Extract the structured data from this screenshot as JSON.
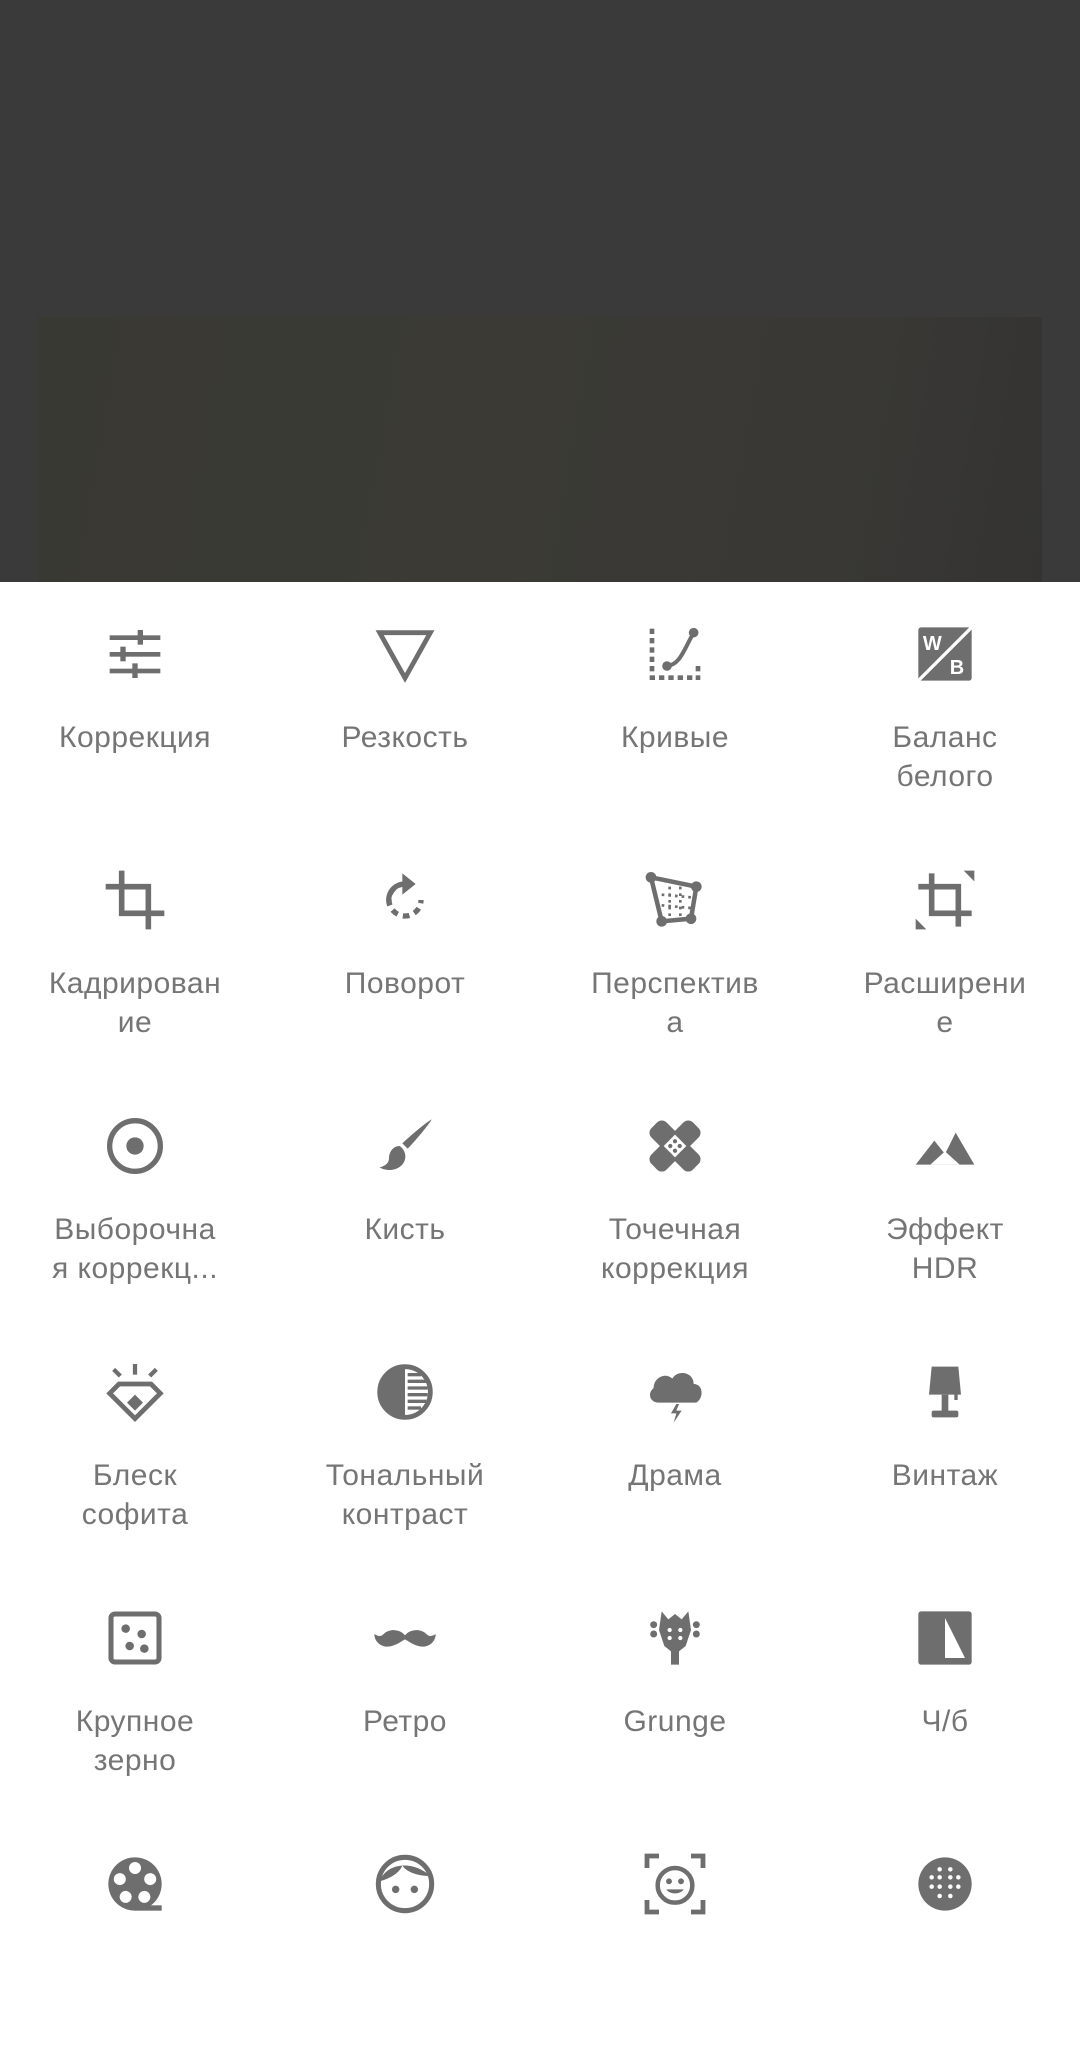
{
  "colors": {
    "icon": "#6e6e6e",
    "label": "#757575",
    "preview_bg": "#3a3a3a",
    "panel_bg": "#ffffff"
  },
  "tools": [
    {
      "id": "tune",
      "icon": "sliders-icon",
      "label": "Коррекция"
    },
    {
      "id": "details",
      "icon": "triangle-down-icon",
      "label": "Резкость"
    },
    {
      "id": "curves",
      "icon": "curve-icon",
      "label": "Кривые"
    },
    {
      "id": "white-balance",
      "icon": "wb-icon",
      "label": "Баланс\nбелого"
    },
    {
      "id": "crop",
      "icon": "crop-icon",
      "label": "Кадрирован\nие"
    },
    {
      "id": "rotate",
      "icon": "rotate-icon",
      "label": "Поворот"
    },
    {
      "id": "perspective",
      "icon": "perspective-icon",
      "label": "Перспектив\nа"
    },
    {
      "id": "expand",
      "icon": "expand-icon",
      "label": "Расширени\nе"
    },
    {
      "id": "selective",
      "icon": "target-icon",
      "label": "Выборочна\nя коррекц..."
    },
    {
      "id": "brush",
      "icon": "brush-icon",
      "label": "Кисть"
    },
    {
      "id": "healing",
      "icon": "bandage-icon",
      "label": "Точечная\nкоррекция"
    },
    {
      "id": "hdr",
      "icon": "mountain-icon",
      "label": "Эффект\nHDR"
    },
    {
      "id": "glamour",
      "icon": "diamond-icon",
      "label": "Блеск\nсофита"
    },
    {
      "id": "tonal",
      "icon": "tonal-icon",
      "label": "Тональный\nконтраст"
    },
    {
      "id": "drama",
      "icon": "cloud-icon",
      "label": "Драма"
    },
    {
      "id": "vintage",
      "icon": "lamp-icon",
      "label": "Винтаж"
    },
    {
      "id": "grain",
      "icon": "grain-icon",
      "label": "Крупное\nзерно"
    },
    {
      "id": "retro",
      "icon": "mustache-icon",
      "label": "Ретро"
    },
    {
      "id": "grunge",
      "icon": "guitar-icon",
      "label": "Grunge"
    },
    {
      "id": "bw",
      "icon": "bw-icon",
      "label": "Ч/б"
    },
    {
      "id": "noir",
      "icon": "film-reel-icon",
      "label": ""
    },
    {
      "id": "portrait",
      "icon": "face-icon",
      "label": ""
    },
    {
      "id": "head-pose",
      "icon": "face-frame-icon",
      "label": ""
    },
    {
      "id": "lens-blur",
      "icon": "dots-circle-icon",
      "label": ""
    }
  ]
}
